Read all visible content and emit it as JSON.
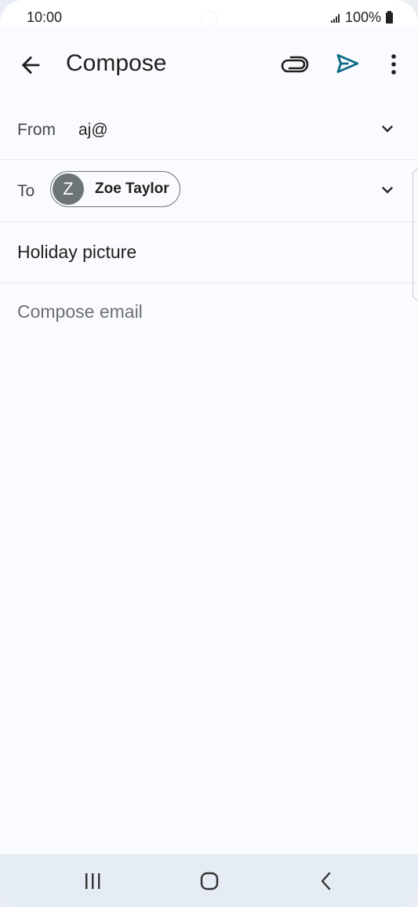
{
  "status_bar": {
    "time": "10:00",
    "battery": "100%"
  },
  "app_bar": {
    "title": "Compose",
    "icons": [
      "back-arrow-icon",
      "paperclip-icon",
      "send-icon",
      "more-vert-icon"
    ],
    "send_color": "#0b6a86"
  },
  "from": {
    "label": "From",
    "value": "aj@"
  },
  "to": {
    "label": "To",
    "recipient_initial": "Z",
    "recipient_name": "Zoe Taylor"
  },
  "subject": {
    "value": "Holiday picture"
  },
  "body": {
    "placeholder": "Compose email"
  },
  "nav_bar": {
    "icons": [
      "recents-icon",
      "home-icon",
      "back-icon"
    ]
  }
}
